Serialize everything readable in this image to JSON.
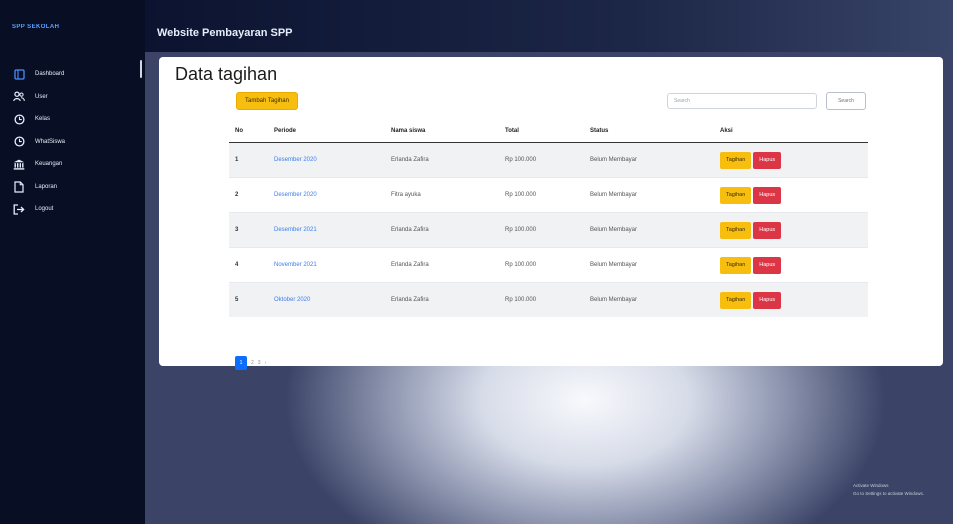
{
  "sidebar": {
    "brand": "SPP SEKOLAH",
    "items": [
      {
        "icon": "dashboard-icon",
        "label": "Dashboard"
      },
      {
        "icon": "users-icon",
        "label": "User"
      },
      {
        "icon": "clock-icon",
        "label": "Kelas"
      },
      {
        "icon": "clock-icon",
        "label": "WhatSiswa"
      },
      {
        "icon": "bank-icon",
        "label": "Keuangan"
      },
      {
        "icon": "file-icon",
        "label": "Laporan"
      },
      {
        "icon": "logout-icon",
        "label": "Logout"
      }
    ]
  },
  "header": {
    "title": "Website Pembayaran SPP"
  },
  "main": {
    "page_title": "Data tagihan",
    "add_button": "Tambah Tagihan",
    "search_placeholder": "Search",
    "search_button": "Search",
    "table": {
      "headers": [
        "No",
        "Periode",
        "Nama siswa",
        "Total",
        "Status",
        "Aksi"
      ],
      "rows": [
        {
          "no": "1",
          "periode": "Desember 2020",
          "nama": "Erlanda Zafira",
          "total": "Rp 100.000",
          "status": "Belum Membayar"
        },
        {
          "no": "2",
          "periode": "Desember 2020",
          "nama": "Fitra ayuka",
          "total": "Rp 100.000",
          "status": "Belum Membayar"
        },
        {
          "no": "3",
          "periode": "Desember 2021",
          "nama": "Erlanda Zafira",
          "total": "Rp 100.000",
          "status": "Belum Membayar"
        },
        {
          "no": "4",
          "periode": "November 2021",
          "nama": "Erlanda Zafira",
          "total": "Rp 100.000",
          "status": "Belum Membayar"
        },
        {
          "no": "5",
          "periode": "Oktober 2020",
          "nama": "Erlanda Zafira",
          "total": "Rp 100.000",
          "status": "Belum Membayar"
        }
      ],
      "action_edit": "Tagihan",
      "action_delete": "Hapus"
    },
    "pagination": [
      "1",
      "2",
      "3",
      "›"
    ]
  },
  "watermark": [
    "Activate Windows",
    "Go to Settings to activate Windows."
  ]
}
